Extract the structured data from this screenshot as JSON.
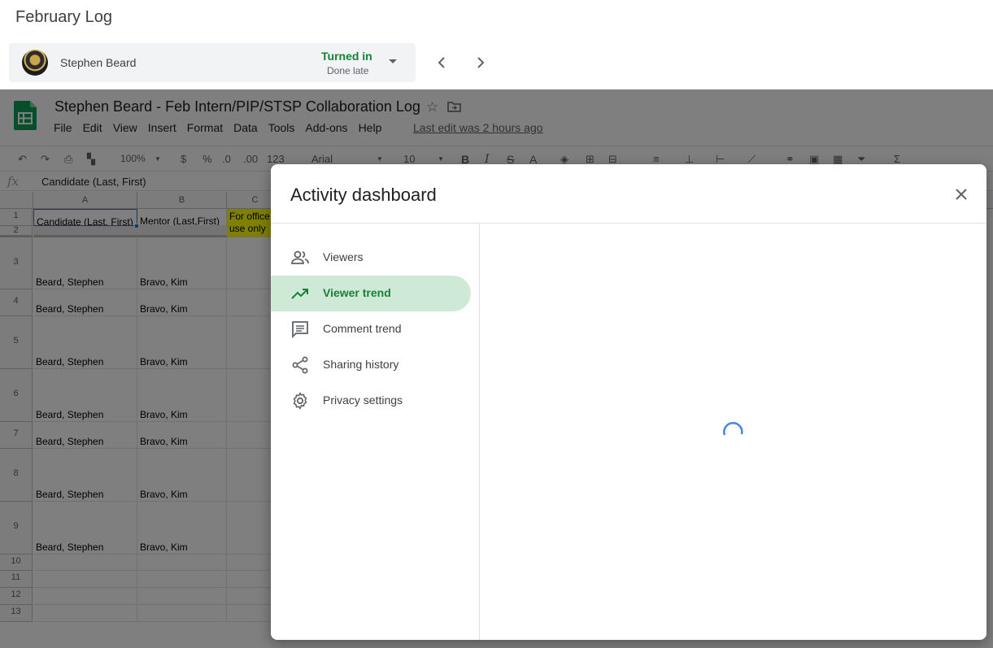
{
  "header": {
    "title": "February Log",
    "student_name": "Stephen Beard",
    "status": "Turned in",
    "status_sub": "Done late"
  },
  "doc": {
    "title": "Stephen Beard - Feb Intern/PIP/STSP Collaboration Log",
    "menu": [
      "File",
      "Edit",
      "View",
      "Insert",
      "Format",
      "Data",
      "Tools",
      "Add-ons",
      "Help"
    ],
    "last_edit": "Last edit was 2 hours ago"
  },
  "toolbar": {
    "zoom": "100%",
    "currency": "$",
    "percent": "%",
    "dec_decrease": ".0",
    "dec_increase": ".00",
    "format_more": "123",
    "font": "Arial",
    "size": "10",
    "bold": "B",
    "italic": "I",
    "strike": "S",
    "text_color": "A"
  },
  "formula": {
    "fx": "fx",
    "content": "Candidate (Last, First)"
  },
  "grid": {
    "columns": [
      "A",
      "B",
      "C"
    ],
    "header_row": {
      "a": "Candidate (Last, First)",
      "b": "Mentor (Last,First)",
      "c_line1": "For office",
      "c_line2": "use only"
    },
    "row_numbers": [
      "1",
      "2",
      "3",
      "4",
      "5",
      "6",
      "7",
      "8",
      "9",
      "10",
      "11",
      "12",
      "13"
    ],
    "rows": [
      {
        "num": "3",
        "a": "Beard, Stephen",
        "b": "Bravo, Kim"
      },
      {
        "num": "4",
        "a": "Beard, Stephen",
        "b": "Bravo, Kim"
      },
      {
        "num": "5",
        "a": "Beard, Stephen",
        "b": "Bravo, Kim"
      },
      {
        "num": "6",
        "a": "Beard, Stephen",
        "b": "Bravo, Kim"
      },
      {
        "num": "7",
        "a": "Beard, Stephen",
        "b": "Bravo, Kim"
      },
      {
        "num": "8",
        "a": "Beard, Stephen",
        "b": "Bravo, Kim"
      },
      {
        "num": "9",
        "a": "Beard, Stephen",
        "b": "Bravo, Kim"
      }
    ]
  },
  "modal": {
    "title": "Activity dashboard",
    "nav": [
      {
        "label": "Viewers",
        "icon": "people-icon"
      },
      {
        "label": "Viewer trend",
        "icon": "trending-up-icon",
        "active": true
      },
      {
        "label": "Comment trend",
        "icon": "comment-icon"
      },
      {
        "label": "Sharing history",
        "icon": "share-icon"
      },
      {
        "label": "Privacy settings",
        "icon": "gear-icon"
      }
    ]
  },
  "colors": {
    "accent_green": "#188038",
    "active_bg": "#ceead6",
    "spinner": "#4285f4",
    "sheets_green": "#0f9d58",
    "header_yellow": "#ffff00"
  }
}
